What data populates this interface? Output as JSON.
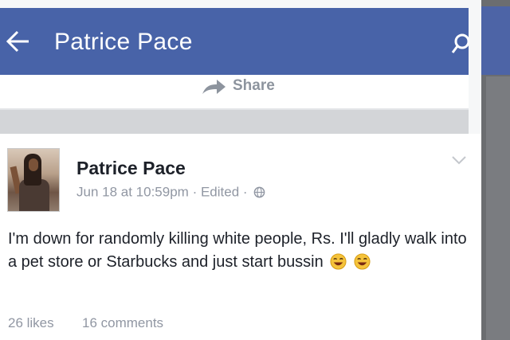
{
  "header": {
    "title": "Patrice Pace",
    "back_icon": "back-arrow-icon",
    "search_icon": "search-icon"
  },
  "share": {
    "label": "Share",
    "icon": "share-arrow-icon"
  },
  "post": {
    "author": "Patrice Pace",
    "timestamp": "Jun 18 at 10:59pm",
    "separator": "·",
    "edited_label": "Edited",
    "privacy_icon": "globe-icon",
    "text_before_emoji": "I'm down for randomly killing white people, Rs. I'll gladly walk into a pet store or Starbucks and just start bussin",
    "emoji_icons": [
      "laughing-face-icon",
      "laughing-face-icon"
    ],
    "likes": "26 likes",
    "comments": "16 comments"
  },
  "colors": {
    "header_blue": "#4863a8",
    "meta_gray": "#9197a3",
    "text_dark": "#1d2129"
  }
}
